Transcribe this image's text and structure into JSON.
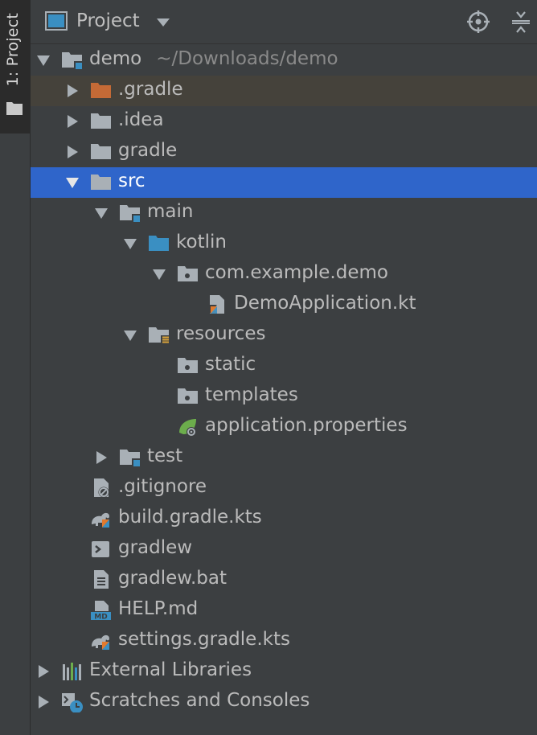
{
  "sidebar": {
    "tab_label": "1: Project"
  },
  "header": {
    "title": "Project"
  },
  "tree": [
    {
      "label": "demo",
      "suffix": "~/Downloads/demo",
      "depth": 0,
      "arrow": "down",
      "icon": "module-folder-icon"
    },
    {
      "label": ".gradle",
      "depth": 1,
      "arrow": "right",
      "icon": "excluded-folder-icon"
    },
    {
      "label": ".idea",
      "depth": 1,
      "arrow": "right",
      "icon": "folder-icon"
    },
    {
      "label": "gradle",
      "depth": 1,
      "arrow": "right",
      "icon": "folder-icon"
    },
    {
      "label": "src",
      "depth": 1,
      "arrow": "down",
      "icon": "folder-icon",
      "selected": true
    },
    {
      "label": "main",
      "depth": 2,
      "arrow": "down",
      "icon": "source-set-folder-icon"
    },
    {
      "label": "kotlin",
      "depth": 3,
      "arrow": "down",
      "icon": "source-root-folder-icon"
    },
    {
      "label": "com.example.demo",
      "depth": 4,
      "arrow": "down",
      "icon": "package-icon"
    },
    {
      "label": "DemoApplication.kt",
      "depth": 5,
      "arrow": "none",
      "icon": "kotlin-file-icon"
    },
    {
      "label": "resources",
      "depth": 3,
      "arrow": "down",
      "icon": "resources-folder-icon"
    },
    {
      "label": "static",
      "depth": 4,
      "arrow": "none",
      "icon": "package-icon"
    },
    {
      "label": "templates",
      "depth": 4,
      "arrow": "none",
      "icon": "package-icon"
    },
    {
      "label": "application.properties",
      "depth": 4,
      "arrow": "none",
      "icon": "spring-properties-icon"
    },
    {
      "label": "test",
      "depth": 2,
      "arrow": "right",
      "icon": "source-set-folder-icon"
    },
    {
      "label": ".gitignore",
      "depth": 1,
      "arrow": "none",
      "icon": "ignore-file-icon"
    },
    {
      "label": "build.gradle.kts",
      "depth": 1,
      "arrow": "none",
      "icon": "gradle-kotlin-file-icon"
    },
    {
      "label": "gradlew",
      "depth": 1,
      "arrow": "none",
      "icon": "shell-script-icon"
    },
    {
      "label": "gradlew.bat",
      "depth": 1,
      "arrow": "none",
      "icon": "text-file-icon"
    },
    {
      "label": "HELP.md",
      "depth": 1,
      "arrow": "none",
      "icon": "markdown-file-icon"
    },
    {
      "label": "settings.gradle.kts",
      "depth": 1,
      "arrow": "none",
      "icon": "gradle-kotlin-file-icon"
    },
    {
      "label": "External Libraries",
      "depth": 0,
      "arrow": "right",
      "icon": "libraries-icon"
    },
    {
      "label": "Scratches and Consoles",
      "depth": 0,
      "arrow": "right",
      "icon": "scratches-icon"
    }
  ],
  "colors": {
    "panel_bg": "#3c3f41",
    "selection": "#2f65ca",
    "excluded_highlight": "#45423b",
    "folder": "#a9b0b6",
    "excluded_folder": "#c46a36",
    "source_root": "#3a8fc2",
    "kotlin_accent": "#e07a2e"
  }
}
